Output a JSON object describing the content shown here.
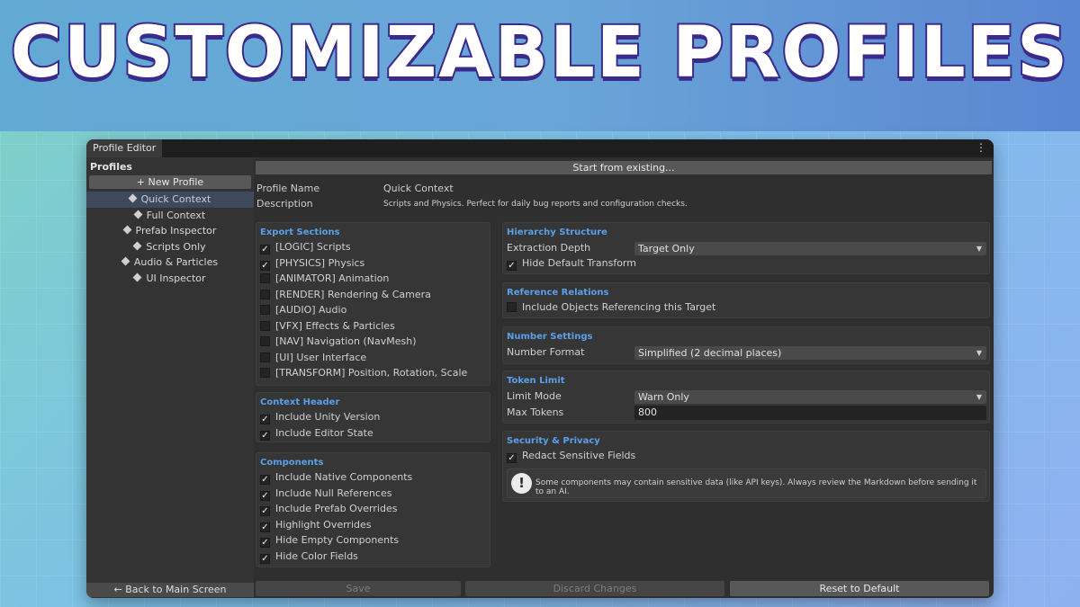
{
  "banner": {
    "headline": "CUSTOMIZABLE PROFILES"
  },
  "window": {
    "tab_title": "Profile Editor",
    "menu_icon": "kebab-menu-icon"
  },
  "sidebar": {
    "title": "Profiles",
    "new_profile_label": "+ New Profile",
    "selected": "Quick Context",
    "items": [
      {
        "label": "Quick Context"
      },
      {
        "label": "Full Context"
      },
      {
        "label": "Prefab Inspector"
      },
      {
        "label": "Scripts Only"
      },
      {
        "label": "Audio & Particles"
      },
      {
        "label": "UI Inspector"
      }
    ],
    "back_label": "← Back to Main Screen"
  },
  "main": {
    "start_label": "Start from existing...",
    "profile_name_label": "Profile Name",
    "profile_name_value": "Quick Context",
    "description_label": "Description",
    "description_value": "Scripts and Physics. Perfect for daily bug reports and configuration checks."
  },
  "export_sections": {
    "title": "Export Sections",
    "items": [
      {
        "label": "[LOGIC] Scripts",
        "checked": true,
        "mark": "✓"
      },
      {
        "label": "[PHYSICS] Physics",
        "checked": true,
        "mark": "✓"
      },
      {
        "label": "[ANIMATOR] Animation",
        "checked": false,
        "mark": ""
      },
      {
        "label": "[RENDER] Rendering & Camera",
        "checked": false,
        "mark": ""
      },
      {
        "label": "[AUDIO] Audio",
        "checked": false,
        "mark": ""
      },
      {
        "label": "[VFX] Effects & Particles",
        "checked": false,
        "mark": ""
      },
      {
        "label": "[NAV] Navigation (NavMesh)",
        "checked": false,
        "mark": ""
      },
      {
        "label": "[UI] User Interface",
        "checked": false,
        "mark": ""
      },
      {
        "label": "[TRANSFORM] Position, Rotation, Scale",
        "checked": false,
        "mark": ""
      }
    ]
  },
  "context_header": {
    "title": "Context Header",
    "items": [
      {
        "label": "Include Unity Version",
        "checked": true,
        "mark": "✓"
      },
      {
        "label": "Include Editor State",
        "checked": true,
        "mark": "✓"
      }
    ]
  },
  "components": {
    "title": "Components",
    "items": [
      {
        "label": "Include Native Components",
        "checked": true,
        "mark": "✓"
      },
      {
        "label": "Include Null References",
        "checked": true,
        "mark": "✓"
      },
      {
        "label": "Include Prefab Overrides",
        "checked": true,
        "mark": "✓"
      },
      {
        "label": "Highlight Overrides",
        "checked": true,
        "mark": "✓"
      },
      {
        "label": "Hide Empty Components",
        "checked": true,
        "mark": "✓"
      },
      {
        "label": "Hide Color Fields",
        "checked": true,
        "mark": "✓"
      }
    ]
  },
  "hierarchy": {
    "title": "Hierarchy Structure",
    "depth_label": "Extraction Depth",
    "depth_value": "Target Only",
    "hide_transform_label": "Hide Default Transform",
    "hide_transform_checked": true,
    "hide_transform_mark": "✓"
  },
  "reference": {
    "title": "Reference Relations",
    "include_label": "Include Objects Referencing this Target",
    "include_checked": false,
    "include_mark": ""
  },
  "number": {
    "title": "Number Settings",
    "format_label": "Number Format",
    "format_value": "Simplified (2 decimal places)"
  },
  "token": {
    "title": "Token Limit",
    "mode_label": "Limit Mode",
    "mode_value": "Warn Only",
    "max_label": "Max Tokens",
    "max_value": "800"
  },
  "security": {
    "title": "Security & Privacy",
    "redact_label": "Redact Sensitive Fields",
    "redact_checked": true,
    "redact_mark": "✓",
    "warning_text": "Some components may contain sensitive data (like API keys). Always review the Markdown before sending it to an AI.",
    "warning_icon": "exclamation-icon"
  },
  "footer": {
    "save_label": "Save",
    "discard_label": "Discard Changes",
    "reset_label": "Reset to Default"
  },
  "colors": {
    "accent_title": "#5aa0e8",
    "headline_outline": "#3a2a8a",
    "window_bg": "#2f2f2f"
  }
}
